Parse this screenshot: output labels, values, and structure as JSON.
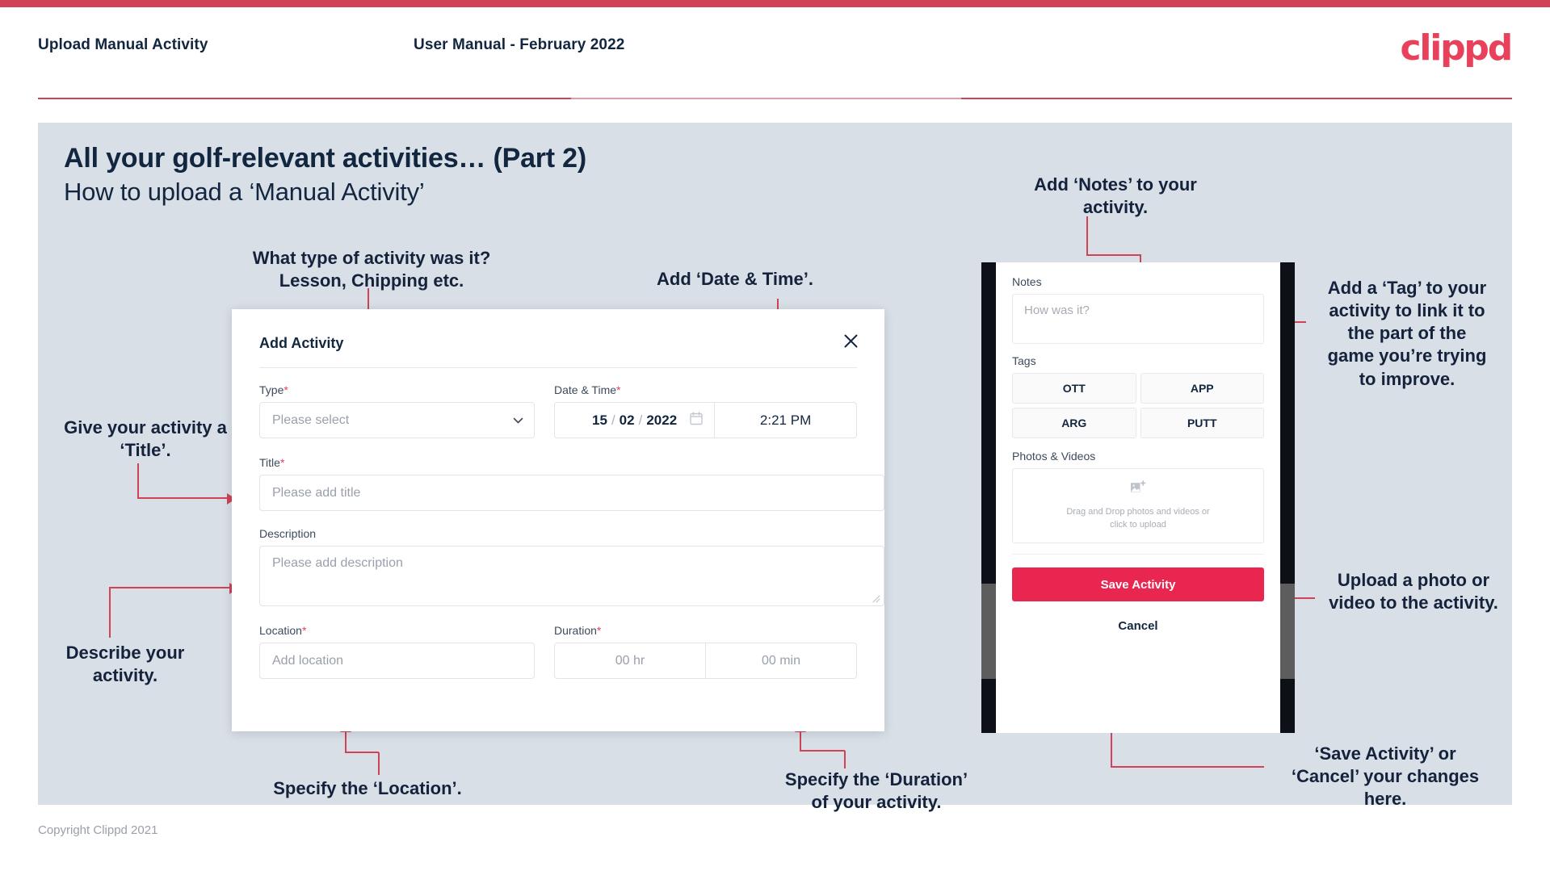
{
  "header": {
    "title": "Upload Manual Activity",
    "subtitle": "User Manual - February 2022",
    "brand": "clippd"
  },
  "slide": {
    "title": "All your golf-relevant activities… (Part 2)",
    "subtitle": "How to upload a ‘Manual Activity’"
  },
  "annotations": {
    "type": "What type of activity was it?\nLesson, Chipping etc.",
    "type_line1": "What type of activity was it?",
    "type_line2": "Lesson, Chipping etc.",
    "datetime": "Add ‘Date & Time’.",
    "title": "Give your activity a\n‘Title’.",
    "title_line1": "Give your activity a",
    "title_line2": "‘Title’.",
    "description_line1": "Describe your",
    "description_line2": "activity.",
    "location": "Specify the ‘Location’.",
    "duration_line1": "Specify the ‘Duration’",
    "duration_line2": "of your activity.",
    "notes_line1": "Add ‘Notes’ to your",
    "notes_line2": "activity.",
    "tags": "Add a ‘Tag’ to your activity to link it to the part of the game you’re trying to improve.",
    "tags_line1": "Add a ‘Tag’ to your",
    "tags_line2": "activity to link it to",
    "tags_line3": "the part of the",
    "tags_line4": "game you’re trying",
    "tags_line5": "to improve.",
    "upload_line1": "Upload a photo or",
    "upload_line2": "video to the activity.",
    "save_line1": "‘Save Activity’ or",
    "save_line2": "‘Cancel’ your changes",
    "save_line3": "here."
  },
  "dialog": {
    "title": "Add Activity",
    "close_icon": "close-icon",
    "fields": {
      "type": {
        "label": "Type",
        "required": "*",
        "value": "",
        "placeholder": "Please select",
        "icon": "chevron-down-icon"
      },
      "datetime": {
        "label": "Date & Time",
        "required": "*",
        "day": "15",
        "sep1": "/",
        "month": "02",
        "sep2": "/",
        "year": "2022",
        "time": "2:21 PM",
        "icon": "calendar-icon"
      },
      "title": {
        "label": "Title",
        "required": "*",
        "value": "",
        "placeholder": "Please add title"
      },
      "description": {
        "label": "Description",
        "required": "",
        "value": "",
        "placeholder": "Please add description"
      },
      "location": {
        "label": "Location",
        "required": "*",
        "value": "",
        "placeholder": "Add location"
      },
      "duration": {
        "label": "Duration",
        "required": "*",
        "hours_placeholder": "00 hr",
        "minutes_placeholder": "00 min"
      }
    }
  },
  "phone": {
    "notes": {
      "label": "Notes",
      "value": "",
      "placeholder": "How was it?"
    },
    "tags": {
      "label": "Tags",
      "options": [
        "OTT",
        "APP",
        "ARG",
        "PUTT"
      ]
    },
    "photos": {
      "label": "Photos & Videos",
      "icon": "add-image-icon",
      "dropzone_line1": "Drag and Drop photos and videos or",
      "dropzone_line2": "click to upload"
    },
    "save_label": "Save Activity",
    "cancel_label": "Cancel"
  },
  "footer": {
    "copyright": "Copyright Clippd 2021"
  },
  "colors": {
    "accent": "#cf4257",
    "brand": "#e8415c",
    "save": "#e8264f",
    "slide_bg": "#d8dfe7",
    "ink": "#12263f"
  }
}
